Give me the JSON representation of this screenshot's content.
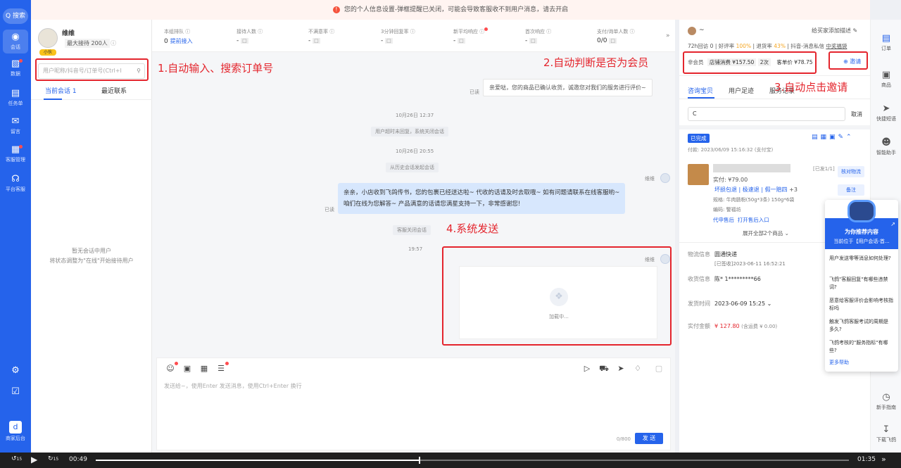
{
  "rail": {
    "search": "Q 搜索",
    "items": [
      {
        "label": "会话",
        "icon": "chat-icon"
      },
      {
        "label": "数据",
        "icon": "bar-chart-icon"
      },
      {
        "label": "任务单",
        "icon": "task-icon"
      },
      {
        "label": "留言",
        "icon": "mail-icon"
      },
      {
        "label": "客服管理",
        "icon": "grid-icon"
      },
      {
        "label": "平台客服",
        "icon": "headset-icon"
      }
    ],
    "bottom_label": "商家后台"
  },
  "banner": {
    "text": "您的个人信息设置-弹框提醒已关闭，可能会导致客服收不到用户消息，请去开启"
  },
  "left": {
    "name": "维维",
    "avatar_tag": "小伙",
    "max_label": "最大接待 200人",
    "search_placeholder": "用户昵称/抖音号/订单号(Ctrl+I",
    "tabs": [
      "当前会话",
      "最近联系"
    ],
    "tab_count": "1",
    "empty_line1": "暂无会话中用户",
    "empty_line2": "将状态调整为\"在线\"开始接待用户"
  },
  "stats": [
    {
      "label": "本组排队",
      "value": "0",
      "link": "提前接入"
    },
    {
      "label": "接待人数",
      "value": "-"
    },
    {
      "label": "不满意率",
      "value": "-"
    },
    {
      "label": "3分钟回复率",
      "value": "-"
    },
    {
      "label": "新平均响应",
      "value": "-"
    },
    {
      "label": "首次响应",
      "value": "-"
    },
    {
      "label": "支付/询单人数",
      "value": "0/0"
    }
  ],
  "chat": {
    "read1": "已读",
    "grey_msg": "亲爱哒，您的商品已确认收货，诚邀您对我们的服务进行评价~",
    "ts1": "10月26日 12:37",
    "sys1": "用户超时未回复，系统关闭会话",
    "ts2": "10月26日 20:55",
    "sys2": "从历史会话发起会话",
    "agent": "维维",
    "blue_line1": "亲亲，小店收到飞鸽传书，您的包裹已经送达啦~ 代收的话请及时去取哦~ 如有问题请联系在线客服哟~",
    "blue_line2": "咱们在线为您解答~ 产品满意的话请您满星支持一下，非常感谢您!",
    "read2": "已读",
    "sys3": "客服关闭会话",
    "ts3": "19:57",
    "agent2": "维维",
    "loading": "加载中..."
  },
  "editor": {
    "placeholder": "发送给~，使用Enter 发送消息，使用Ctrl+Enter 换行",
    "counter": "0/800",
    "send": "发 送"
  },
  "right": {
    "user_name": "~",
    "add_desc": "给买家添加描述",
    "metric1": "72h回访 0",
    "metric2": "好评率",
    "metric2_val": "100%",
    "metric3": "退货率",
    "metric3_val": "43%",
    "metric4": "抖音-消息私信",
    "metric5": "中奖福袋",
    "member": "非会员",
    "shop_spend": "店铺消费 ¥157.50",
    "times": "2次",
    "avg": "客单价 ¥78.75",
    "invite": "邀请",
    "tabs": [
      "咨询宝贝",
      "用户足迹",
      "服务记录"
    ],
    "search_char": "C",
    "cancel": "取消",
    "order_status": "已完成",
    "order_time": "付款: 2023/06/09 15:16:32 (支付宝)",
    "shipped": "[已发1/1]",
    "paid": "实付: ¥79.00",
    "tag1": "坏损包退",
    "tag2": "极速退",
    "tag3": "假一赔四",
    "tag_more": "+3",
    "spec": "规格: 牛肉肠粉(50g*3条) 150g*6袋",
    "code": "编码: 警福坊",
    "refund": "代申售后",
    "print": "打开售后入口",
    "expand": "展开全部2个商品",
    "btn_verify": "核对物流",
    "btn_remark": "备注",
    "logistics_k": "物流信息",
    "logistics_v": "圆通快递",
    "logistics_sub": "[已签收]2023-06-11 16:52:21",
    "address_k": "收货信息",
    "address_v": "陈* 1*********66",
    "ship_k": "发货时间",
    "ship_v": "2023-06-09 15:25",
    "pay_k": "实付金额",
    "pay_v": "¥ 127.80",
    "pay_sub": "(含运费 ¥ 0.00)"
  },
  "rrail": [
    {
      "label": "订单",
      "icon": "order-icon"
    },
    {
      "label": "商品",
      "icon": "goods-icon"
    },
    {
      "label": "快捷短语",
      "icon": "send-icon"
    },
    {
      "label": "智能助手",
      "icon": "robot-icon"
    },
    {
      "label": "新手指南",
      "icon": "guide-icon"
    },
    {
      "label": "下载飞鸽",
      "icon": "download-icon"
    }
  ],
  "popup": {
    "title": "为你推荐内容",
    "subtitle": "当前位于【用户会话-首...",
    "q1": "用户发送零等消息如何处理?",
    "q2": "飞鸽\"客服回复\"有哪些违禁词?",
    "q3": "恶意给客服评价会影响考核指标吗",
    "q4": "触发飞鸽客服考试的周期是 多久?",
    "q5": "飞鸽考核的\"服务指标\"有哪些?",
    "more": "更多帮助"
  },
  "annotations": {
    "a1": "1.自动输入、搜索订单号",
    "a2": "2.自动判断是否为会员",
    "a3": "3.自动点击邀请",
    "a4": "4.系统发送"
  },
  "player": {
    "current": "00:49",
    "total": "01:35",
    "skip_back": "15",
    "skip_fwd": "15",
    "progress": 0.43
  },
  "colors": {
    "brand": "#2563eb",
    "annotation": "#e4252d"
  }
}
